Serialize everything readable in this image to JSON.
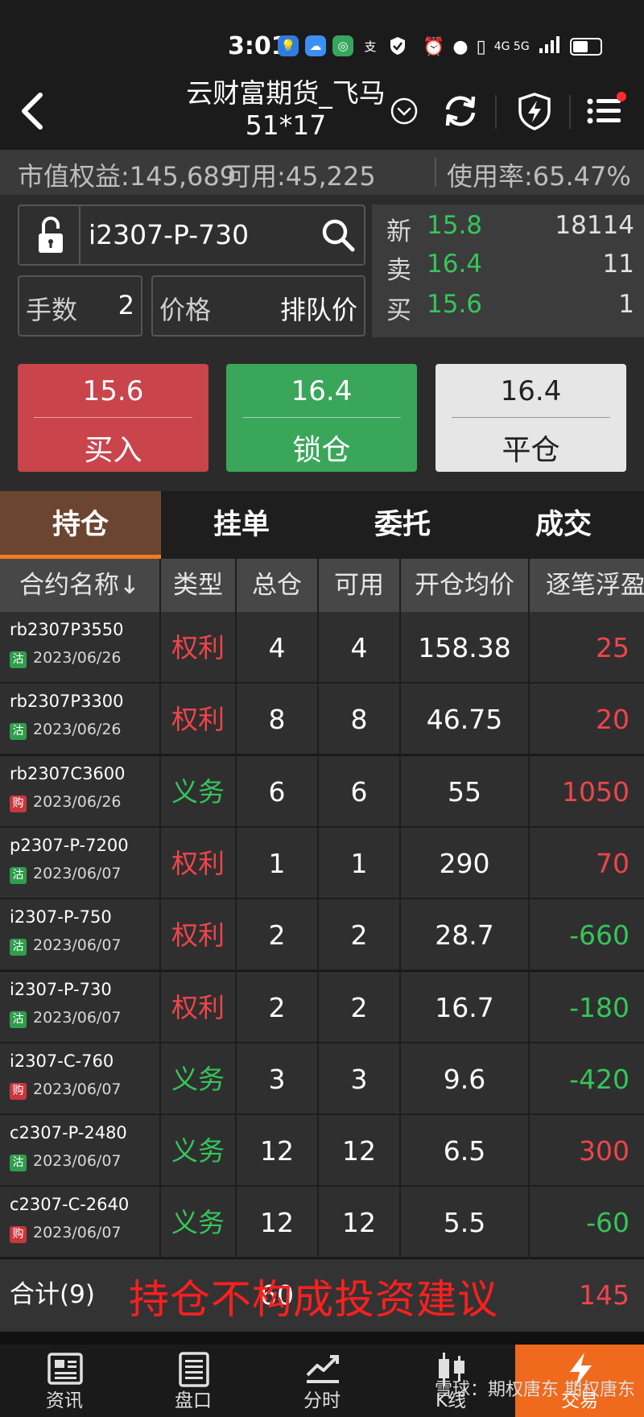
{
  "status_bar": {
    "time": "3:01",
    "network": "4G 5G"
  },
  "header": {
    "title_line1": "云财富期货_飞马",
    "title_line2": "51*17"
  },
  "account": {
    "equity": "市值权益:145,689",
    "available": "可用:45,225",
    "usage": "使用率:65.47%"
  },
  "order": {
    "contract": "i2307-P-730",
    "lots_label": "手数",
    "lots_value": "2",
    "price_label": "价格",
    "price_value": "排队价"
  },
  "quote": {
    "last_label": "新",
    "last_price": "15.8",
    "volume": "18114",
    "ask_label": "卖",
    "ask_price": "16.4",
    "ask_qty": "11",
    "bid_label": "买",
    "bid_price": "15.6",
    "bid_qty": "1"
  },
  "trade_buttons": {
    "buy": {
      "price": "15.6",
      "label": "买入"
    },
    "lock": {
      "price": "16.4",
      "label": "锁仓"
    },
    "close": {
      "price": "16.4",
      "label": "平仓"
    }
  },
  "tabs": [
    "持仓",
    "挂单",
    "委托",
    "成交"
  ],
  "columns": [
    "合约名称↓",
    "类型",
    "总仓",
    "可用",
    "开仓均价",
    "逐笔浮盈"
  ],
  "positions": [
    {
      "name": "rb2307P3550",
      "tag": "沽",
      "date": "2023/06/26",
      "type": "权利",
      "total": "4",
      "avail": "4",
      "avg": "158.38",
      "pnl": "25"
    },
    {
      "name": "rb2307P3300",
      "tag": "沽",
      "date": "2023/06/26",
      "type": "权利",
      "total": "8",
      "avail": "8",
      "avg": "46.75",
      "pnl": "20"
    },
    {
      "name": "rb2307C3600",
      "tag": "购",
      "date": "2023/06/26",
      "type": "义务",
      "total": "6",
      "avail": "6",
      "avg": "55",
      "pnl": "1050"
    },
    {
      "name": "p2307-P-7200",
      "tag": "沽",
      "date": "2023/06/07",
      "type": "权利",
      "total": "1",
      "avail": "1",
      "avg": "290",
      "pnl": "70"
    },
    {
      "name": "i2307-P-750",
      "tag": "沽",
      "date": "2023/06/07",
      "type": "权利",
      "total": "2",
      "avail": "2",
      "avg": "28.7",
      "pnl": "-660"
    },
    {
      "name": "i2307-P-730",
      "tag": "沽",
      "date": "2023/06/07",
      "type": "权利",
      "total": "2",
      "avail": "2",
      "avg": "16.7",
      "pnl": "-180"
    },
    {
      "name": "i2307-C-760",
      "tag": "购",
      "date": "2023/06/07",
      "type": "义务",
      "total": "3",
      "avail": "3",
      "avg": "9.6",
      "pnl": "-420"
    },
    {
      "name": "c2307-P-2480",
      "tag": "沽",
      "date": "2023/06/07",
      "type": "义务",
      "total": "12",
      "avail": "12",
      "avg": "6.5",
      "pnl": "300"
    },
    {
      "name": "c2307-C-2640",
      "tag": "购",
      "date": "2023/06/07",
      "type": "义务",
      "total": "12",
      "avail": "12",
      "avg": "5.5",
      "pnl": "-60"
    }
  ],
  "total_row": {
    "label": "合计(9)",
    "total": "60",
    "pnl": "145"
  },
  "watermark_text": "持仓不构成投资建议",
  "bottom_nav": [
    "资讯",
    "盘口",
    "分时",
    "K线",
    "交易"
  ],
  "credit_text": "雪球：期权唐东 期权唐东",
  "colors": {
    "red": "#f0444b",
    "green": "#35c559",
    "buy_bg": "#c9444b",
    "lock_bg": "#3aa65a",
    "close_bg": "#e6e6e6",
    "accent": "#ef6a1d",
    "tag_put": "#2f9e4c",
    "tag_call": "#c8373d"
  }
}
